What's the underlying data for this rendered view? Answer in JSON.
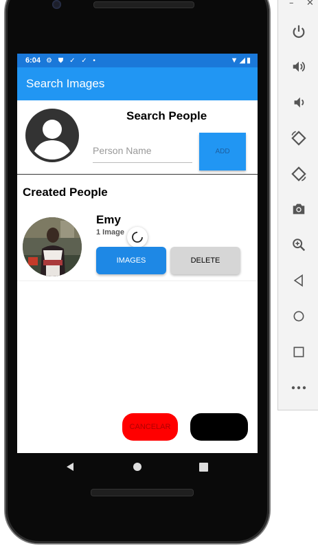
{
  "status_bar": {
    "time": "6:04",
    "left_icons": [
      "gear-icon",
      "shield-icon",
      "download-check-icon",
      "download-check-icon",
      "dot-icon"
    ],
    "right_icons": [
      "wifi-icon",
      "signal-icon",
      "battery-icon"
    ]
  },
  "app_bar": {
    "title": "Search Images"
  },
  "search_section": {
    "title": "Search People",
    "input_placeholder": "Person Name",
    "input_value": "",
    "add_label": "ADD"
  },
  "created_section": {
    "title": "Created People",
    "people": [
      {
        "name": "Emy",
        "count": "1 Image",
        "images_label": "IMAGES",
        "delete_label": "DELETE"
      }
    ]
  },
  "bottom_actions": {
    "cancel_label": "CANCELAR",
    "black_label": ""
  },
  "navigation": [
    "back-icon",
    "home-icon",
    "recents-icon"
  ],
  "emulator_panel": {
    "window_controls": [
      "–",
      "✕"
    ],
    "buttons": [
      "power-icon",
      "volume-up-icon",
      "volume-down-icon",
      "rotate-left-icon",
      "rotate-right-icon",
      "camera-icon",
      "zoom-icon",
      "back-icon",
      "home-icon",
      "overview-icon",
      "more-icon"
    ]
  },
  "colors": {
    "app_bar": "#2196f3",
    "status_bar": "#1a78d9",
    "images_button": "#1e88e5",
    "delete_button": "#d6d6d6",
    "cancel_button": "#ff0000"
  }
}
